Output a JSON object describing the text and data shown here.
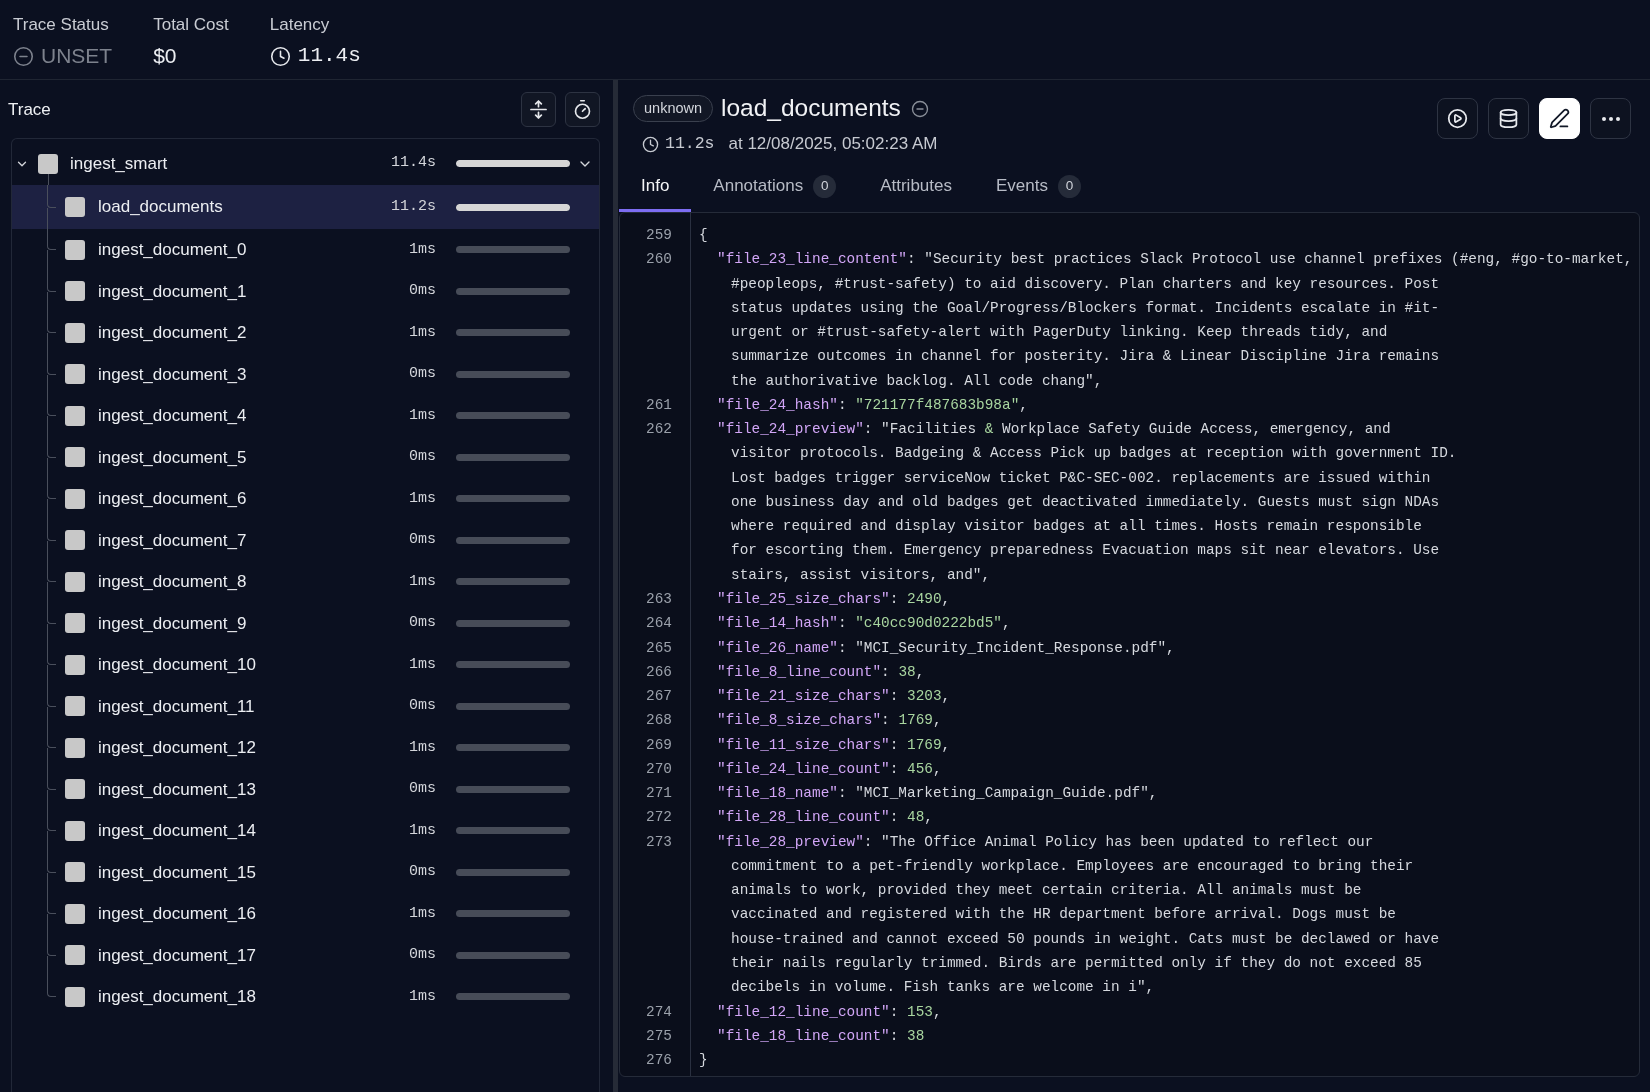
{
  "summary": [
    {
      "label": "Trace Status",
      "value": "UNSET",
      "kind": "status"
    },
    {
      "label": "Total Cost",
      "value": "$0",
      "kind": "plain"
    },
    {
      "label": "Latency",
      "value": "11.4s",
      "kind": "latency"
    }
  ],
  "trace": {
    "title": "Trace",
    "spans": [
      {
        "name": "ingest_smart",
        "duration": "11.4s",
        "level": 1,
        "expanded": true,
        "selected": false,
        "children": [
          {
            "name": "load_documents",
            "duration": "11.2s",
            "level": 1,
            "selected": true
          },
          {
            "name": "ingest_document_0",
            "duration": "1ms",
            "selected": false
          },
          {
            "name": "ingest_document_1",
            "duration": "0ms",
            "selected": false
          },
          {
            "name": "ingest_document_2",
            "duration": "1ms",
            "selected": false
          },
          {
            "name": "ingest_document_3",
            "duration": "0ms",
            "selected": false
          },
          {
            "name": "ingest_document_4",
            "duration": "1ms",
            "selected": false
          },
          {
            "name": "ingest_document_5",
            "duration": "0ms",
            "selected": false
          },
          {
            "name": "ingest_document_6",
            "duration": "1ms",
            "selected": false
          },
          {
            "name": "ingest_document_7",
            "duration": "0ms",
            "selected": false
          },
          {
            "name": "ingest_document_8",
            "duration": "1ms",
            "selected": false
          },
          {
            "name": "ingest_document_9",
            "duration": "0ms",
            "selected": false
          },
          {
            "name": "ingest_document_10",
            "duration": "1ms",
            "selected": false
          },
          {
            "name": "ingest_document_11",
            "duration": "0ms",
            "selected": false
          },
          {
            "name": "ingest_document_12",
            "duration": "1ms",
            "selected": false
          },
          {
            "name": "ingest_document_13",
            "duration": "0ms",
            "selected": false
          },
          {
            "name": "ingest_document_14",
            "duration": "1ms",
            "selected": false
          },
          {
            "name": "ingest_document_15",
            "duration": "0ms",
            "selected": false
          },
          {
            "name": "ingest_document_16",
            "duration": "1ms",
            "selected": false
          },
          {
            "name": "ingest_document_17",
            "duration": "0ms",
            "selected": false
          },
          {
            "name": "ingest_document_18",
            "duration": "1ms",
            "selected": false
          }
        ]
      }
    ]
  },
  "detail": {
    "badge": "unknown",
    "title": "load_documents",
    "duration": "11.2s",
    "timestamp": "at 12/08/2025, 05:02:23 AM",
    "actions": [
      {
        "kind": "outline"
      },
      {
        "kind": "outline"
      },
      {
        "kind": "solid"
      },
      {
        "kind": "outline"
      }
    ]
  },
  "tabs": [
    {
      "label": "Info",
      "selected": true
    },
    {
      "label": "Annotations",
      "count": "0",
      "selected": false
    },
    {
      "label": "Attributes",
      "selected": false
    },
    {
      "label": "Events",
      "count": "0",
      "selected": false
    }
  ],
  "code_lines": [
    {
      "number": "259",
      "kind": "brace",
      "tokens": [
        {
          "kind": "text",
          "text": "{"
        }
      ]
    },
    {
      "number": "260",
      "kind": "entry",
      "tokens": [
        {
          "kind": "key",
          "text": "\"file_23_line_content\""
        },
        {
          "kind": "text",
          "text": ": \"Security best practices Slack Protocol use channel prefixes (#eng, #go-to-market,\n#peopleops, #trust-safety) to aid discovery. Plan charters and key resources. Post\nstatus updates using the Goal/Progress/Blockers format. Incidents escalate in #it-\nurgent or #trust-safety-alert with PagerDuty linking. Keep threads tidy, and\nsummarize outcomes in channel for posterity. Jira & Linear Discipline Jira remains\nthe authorivative backlog. All code chang\","
        }
      ]
    },
    {
      "number": "261",
      "kind": "entry",
      "tokens": [
        {
          "kind": "key",
          "text": "\"file_24_hash\""
        },
        {
          "kind": "text",
          "text": ": "
        },
        {
          "kind": "literal",
          "text": "\"721177f487683b98a\""
        },
        {
          "kind": "text",
          "text": ","
        }
      ]
    },
    {
      "number": "262",
      "kind": "entry",
      "tokens": [
        {
          "kind": "key",
          "text": "\"file_24_preview\""
        },
        {
          "kind": "text",
          "text": ": \"Facilities "
        },
        {
          "kind": "literal",
          "text": "&"
        },
        {
          "kind": "text",
          "text": " Workplace Safety Guide Access, emergency, and\nvisitor protocols. Badgeing & Access Pick up badges at reception with government ID.\nLost badges trigger serviceNow ticket P&C-SEC-002. replacements are issued within\none business day and old badges get deactivated immediately. Guests must sign NDAs\nwhere required and display visitor badges at all times. Hosts remain responsible\nfor escorting them. Emergency preparedness Evacuation maps sit near elevators. Use\nstairs, assist visitors, and\","
        }
      ]
    },
    {
      "number": "263",
      "kind": "entry",
      "tokens": [
        {
          "kind": "key",
          "text": "\"file_25_size_chars\""
        },
        {
          "kind": "text",
          "text": ": "
        },
        {
          "kind": "literal",
          "text": "2490"
        },
        {
          "kind": "text",
          "text": ","
        }
      ]
    },
    {
      "number": "264",
      "kind": "entry",
      "tokens": [
        {
          "kind": "key",
          "text": "\"file_14_hash\""
        },
        {
          "kind": "text",
          "text": ": "
        },
        {
          "kind": "literal",
          "text": "\"c40cc90d0222bd5\""
        },
        {
          "kind": "text",
          "text": ","
        }
      ]
    },
    {
      "number": "265",
      "kind": "entry",
      "tokens": [
        {
          "kind": "key",
          "text": "\"file_26_name\""
        },
        {
          "kind": "text",
          "text": ": \"MCI_Security_Incident_Response.pdf\","
        }
      ]
    },
    {
      "number": "266",
      "kind": "entry",
      "tokens": [
        {
          "kind": "key",
          "text": "\"file_8_line_count\""
        },
        {
          "kind": "text",
          "text": ": "
        },
        {
          "kind": "literal",
          "text": "38"
        },
        {
          "kind": "text",
          "text": ","
        }
      ]
    },
    {
      "number": "267",
      "kind": "entry",
      "tokens": [
        {
          "kind": "key",
          "text": "\"file_21_size_chars\""
        },
        {
          "kind": "text",
          "text": ": "
        },
        {
          "kind": "literal",
          "text": "3203"
        },
        {
          "kind": "text",
          "text": ","
        }
      ]
    },
    {
      "number": "268",
      "kind": "entry",
      "tokens": [
        {
          "kind": "key",
          "text": "\"file_8_size_chars\""
        },
        {
          "kind": "text",
          "text": ": "
        },
        {
          "kind": "literal",
          "text": "1769"
        },
        {
          "kind": "text",
          "text": ","
        }
      ]
    },
    {
      "number": "269",
      "kind": "entry",
      "tokens": [
        {
          "kind": "key",
          "text": "\"file_11_size_chars\""
        },
        {
          "kind": "text",
          "text": ": "
        },
        {
          "kind": "literal",
          "text": "1769"
        },
        {
          "kind": "text",
          "text": ","
        }
      ]
    },
    {
      "number": "270",
      "kind": "entry",
      "tokens": [
        {
          "kind": "key",
          "text": "\"file_24_line_count\""
        },
        {
          "kind": "text",
          "text": ": "
        },
        {
          "kind": "literal",
          "text": "456"
        },
        {
          "kind": "text",
          "text": ","
        }
      ]
    },
    {
      "number": "271",
      "kind": "entry",
      "tokens": [
        {
          "kind": "key",
          "text": "\"file_18_name\""
        },
        {
          "kind": "text",
          "text": ": \"MCI_Marketing_Campaign_Guide.pdf\","
        }
      ]
    },
    {
      "number": "272",
      "kind": "entry",
      "tokens": [
        {
          "kind": "key",
          "text": "\"file_28_line_count\""
        },
        {
          "kind": "text",
          "text": ": "
        },
        {
          "kind": "literal",
          "text": "48"
        },
        {
          "kind": "text",
          "text": ","
        }
      ]
    },
    {
      "number": "273",
      "kind": "entry",
      "tokens": [
        {
          "kind": "key",
          "text": "\"file_28_preview\""
        },
        {
          "kind": "text",
          "text": ": \"The Office Animal Policy has been updated to reflect our\ncommitment to a pet-friendly workplace. Employees are encouraged to bring their\nanimals to work, provided they meet certain criteria. All animals must be\nvaccinated and registered with the HR department before arrival. Dogs must be\nhouse-trained and cannot exceed 50 pounds in weight. Cats must be declawed or have\ntheir nails regularly trimmed. Birds are permitted only if they do not exceed 85\ndecibels in volume. Fish tanks are welcome in i\","
        }
      ]
    },
    {
      "number": "274",
      "kind": "entry",
      "tokens": [
        {
          "kind": "key",
          "text": "\"file_12_line_count\""
        },
        {
          "kind": "text",
          "text": ": "
        },
        {
          "kind": "literal",
          "text": "153"
        },
        {
          "kind": "text",
          "text": ","
        }
      ]
    },
    {
      "number": "275",
      "kind": "entry",
      "tokens": [
        {
          "kind": "key",
          "text": "\"file_18_line_count\""
        },
        {
          "kind": "text",
          "text": ": "
        },
        {
          "kind": "literal",
          "text": "38"
        }
      ]
    },
    {
      "number": "276",
      "kind": "brace",
      "tokens": [
        {
          "kind": "text",
          "text": "}"
        }
      ]
    }
  ]
}
